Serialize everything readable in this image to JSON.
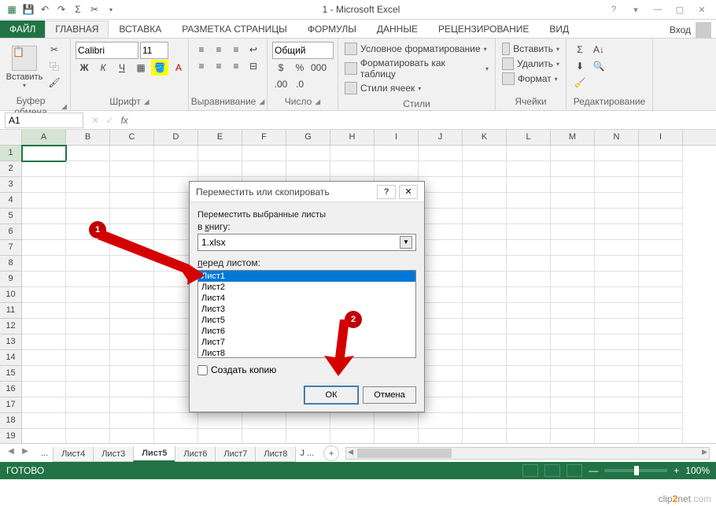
{
  "title": "1 - Microsoft Excel",
  "qat": {
    "save": "💾",
    "undo": "↶",
    "redo": "↷",
    "sum": "Σ",
    "cut": "✂"
  },
  "win": {
    "help": "?",
    "opts": "▾",
    "min": "—",
    "max": "▢",
    "close": "✕"
  },
  "tabs": {
    "file": "ФАЙЛ",
    "items": [
      "ГЛАВНАЯ",
      "ВСТАВКА",
      "РАЗМЕТКА СТРАНИЦЫ",
      "ФОРМУЛЫ",
      "ДАННЫЕ",
      "РЕЦЕНЗИРОВАНИЕ",
      "ВИД"
    ],
    "active": 0,
    "login": "Вход"
  },
  "ribbon": {
    "clipboard": {
      "paste": "Вставить",
      "label": "Буфер обмена"
    },
    "font": {
      "name": "Calibri",
      "size": "11",
      "label": "Шрифт",
      "bold": "Ж",
      "italic": "К",
      "underline": "Ч"
    },
    "align": {
      "label": "Выравнивание"
    },
    "number": {
      "format": "Общий",
      "label": "Число"
    },
    "styles": {
      "cond": "Условное форматирование",
      "table": "Форматировать как таблицу",
      "cell": "Стили ячеек",
      "label": "Стили"
    },
    "cells": {
      "insert": "Вставить",
      "delete": "Удалить",
      "format": "Формат",
      "label": "Ячейки"
    },
    "editing": {
      "label": "Редактирование"
    }
  },
  "fbar": {
    "name": "A1",
    "fx": "fx"
  },
  "columns": [
    "A",
    "B",
    "C",
    "D",
    "E",
    "F",
    "G",
    "H",
    "I",
    "J",
    "K",
    "L",
    "M",
    "N",
    "I"
  ],
  "rows": [
    1,
    2,
    3,
    4,
    5,
    6,
    7,
    8,
    9,
    10,
    11,
    12,
    13,
    14,
    15,
    16,
    17,
    18,
    19
  ],
  "active_col": 0,
  "active_row": 0,
  "sheets": {
    "nav_dots": "...",
    "tabs": [
      "Лист4",
      "Лист3",
      "Лист5",
      "Лист6",
      "Лист7",
      "Лист8"
    ],
    "trailing": "J ...",
    "active": 2
  },
  "status": {
    "ready": "ГОТОВО",
    "zoom": "100%",
    "minus": "—",
    "plus": "+"
  },
  "dialog": {
    "title": "Переместить или скопировать",
    "label1": "Переместить выбранные листы",
    "label2_pre": "в",
    "label2_u": "к",
    "label2_post": "нигу:",
    "book": "1.xlsx",
    "label3_u": "п",
    "label3_post": "еред листом:",
    "sheets": [
      "Лист1",
      "Лист2",
      "Лист4",
      "Лист3",
      "Лист5",
      "Лист6",
      "Лист7",
      "Лист8"
    ],
    "selected": 0,
    "copy_check": "Создать копию",
    "ok": "ОК",
    "cancel": "Отмена"
  },
  "annotations": {
    "badge1": "1",
    "badge2": "2"
  },
  "watermark": {
    "p1": "clip",
    "p2": "2",
    "p3": "net",
    "p4": ".com"
  }
}
